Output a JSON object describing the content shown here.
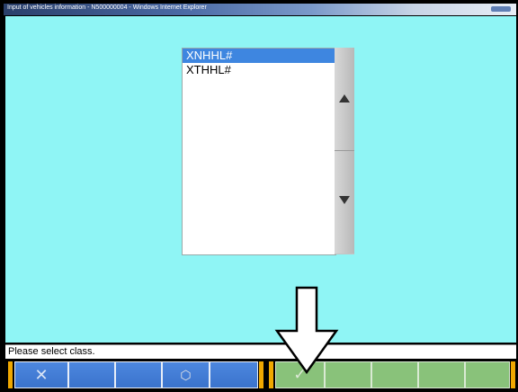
{
  "window": {
    "title": "Input of vehicles information - N500000004 - Windows Internet Explorer"
  },
  "class_list": {
    "items": [
      "XNHHL#",
      "XTHHL#"
    ],
    "selected_index": 0
  },
  "status": {
    "message": "Please select class."
  },
  "toolbar": {
    "cancel_icon": "x-icon",
    "box_icon": "cube-icon",
    "confirm_icon": "check-icon",
    "glyphs": {
      "cancel": "✕",
      "box": "⬡",
      "confirm": "✓"
    }
  },
  "colors": {
    "background": "#8ff5f5",
    "selection": "#3e86e0",
    "toolbar_blue": "#4a80d8",
    "toolbar_green": "#89c27a",
    "accent_orange": "#f0a800"
  }
}
